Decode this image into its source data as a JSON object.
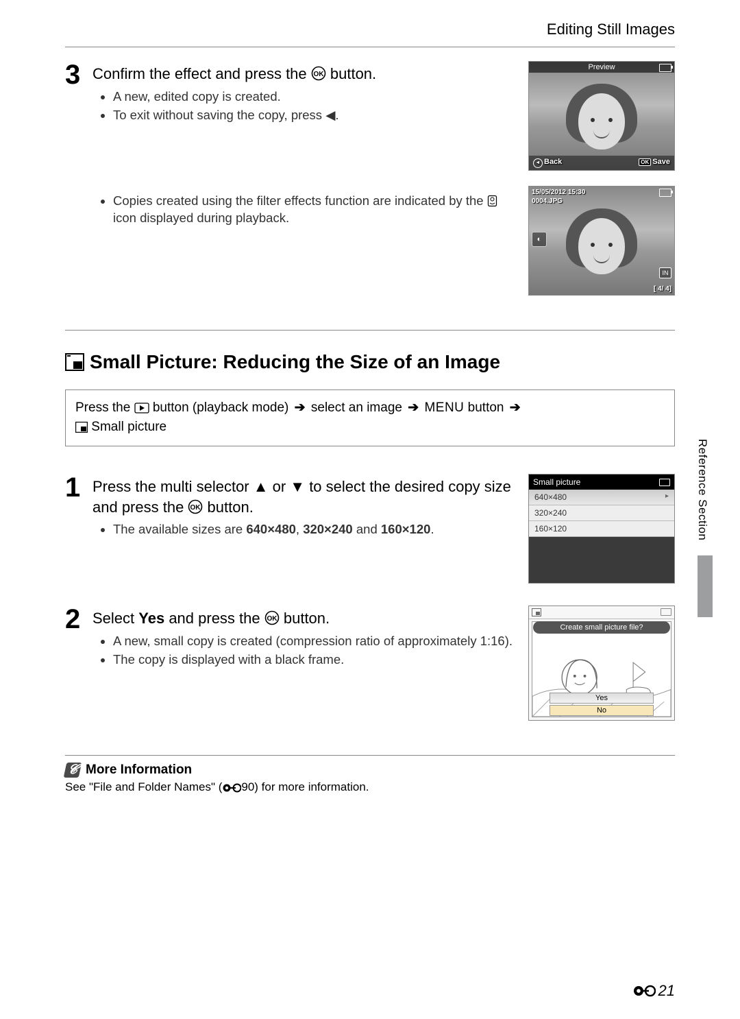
{
  "header": "Editing Still Images",
  "side_label": "Reference Section",
  "page_number": "21",
  "step3": {
    "num": "3",
    "line_a": "Confirm the effect and press the ",
    "line_b": " button.",
    "bullets_a": [
      "A new, edited copy is created.",
      "To exit without saving the copy, press ◀."
    ],
    "bullets_b_prefix": "Copies created using the filter effects function are indicated by the ",
    "bullets_b_suffix": " icon displayed during playback."
  },
  "lcd_preview": {
    "title": "Preview",
    "back": "Back",
    "save": "Save"
  },
  "lcd_playback": {
    "date": "15/05/2012  15:30",
    "file": "0004.JPG",
    "counter": "[      4/      4]",
    "in_icon": "IN"
  },
  "section_title": "Small Picture: Reducing the Size of an Image",
  "nav_box": {
    "a": "Press the ",
    "b": " button (playback mode) ",
    "c": " select an image ",
    "d": " button ",
    "e": " Small picture",
    "menu_word": "MENU"
  },
  "step1": {
    "num": "1",
    "line_a": "Press the multi selector ▲ or ▼ to select the desired copy size and press the ",
    "line_b": " button.",
    "bullet_a": "The available sizes are ",
    "size1": "640×480",
    "sep1": ", ",
    "size2": "320×240",
    "sep2": " and ",
    "size3": "160×120",
    "tail": "."
  },
  "menu_lcd": {
    "title": "Small picture",
    "rows": [
      "640×480",
      "320×240",
      "160×120"
    ]
  },
  "step2": {
    "num": "2",
    "line_a": "Select ",
    "yes": "Yes",
    "line_b": " and press the ",
    "line_c": " button.",
    "bullets": [
      "A new, small copy is created (compression ratio of approximately 1:16).",
      "The copy is displayed with a black frame."
    ]
  },
  "dialog_lcd": {
    "prompt": "Create small picture file?",
    "yes": "Yes",
    "no": "No"
  },
  "more_info": {
    "head": "More Information",
    "text_a": "See \"File and Folder Names\" (",
    "text_b": "90) for more information."
  }
}
